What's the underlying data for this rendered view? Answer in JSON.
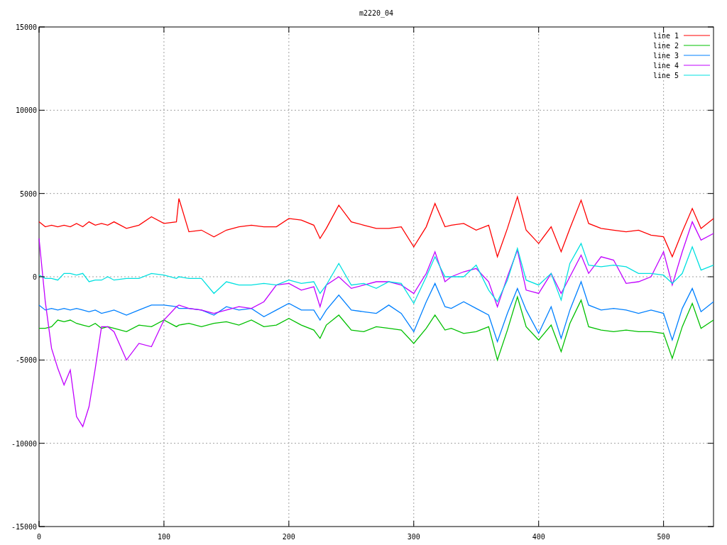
{
  "chart": {
    "chart_data": {
      "type": "line",
      "title": "m2220_04",
      "grid": true,
      "legend": true,
      "xlim": [
        0,
        540
      ],
      "ylim": [
        -15000,
        15000
      ],
      "xticks": [
        0,
        100,
        200,
        300,
        400,
        500
      ],
      "yticks": [
        -15000,
        -10000,
        -5000,
        0,
        5000,
        10000,
        15000
      ],
      "x": [
        0,
        5,
        10,
        15,
        20,
        25,
        30,
        35,
        40,
        45,
        50,
        55,
        60,
        70,
        80,
        90,
        100,
        110,
        112,
        120,
        130,
        140,
        150,
        160,
        170,
        180,
        190,
        200,
        210,
        220,
        225,
        230,
        240,
        250,
        260,
        270,
        280,
        290,
        300,
        310,
        317,
        325,
        330,
        340,
        350,
        360,
        367,
        375,
        383,
        390,
        400,
        410,
        418,
        425,
        434,
        440,
        450,
        460,
        470,
        480,
        490,
        500,
        507,
        515,
        523,
        530,
        540
      ],
      "series": [
        {
          "name": "line 1",
          "color": "#ff0000",
          "values": [
            3300,
            3000,
            3100,
            3000,
            3100,
            3000,
            3200,
            3000,
            3300,
            3100,
            3200,
            3100,
            3300,
            2900,
            3100,
            3600,
            3200,
            3300,
            4700,
            2700,
            2800,
            2400,
            2800,
            3000,
            3100,
            3000,
            3000,
            3500,
            3400,
            3100,
            2300,
            2900,
            4300,
            3300,
            3100,
            2900,
            2900,
            3000,
            1800,
            3000,
            4400,
            3000,
            3100,
            3200,
            2800,
            3100,
            1200,
            2900,
            4800,
            2800,
            2000,
            3000,
            1500,
            2900,
            4600,
            3200,
            2900,
            2800,
            2700,
            2800,
            2500,
            2400,
            1200,
            2700,
            4100,
            2900,
            3500
          ]
        },
        {
          "name": "line 2",
          "color": "#00c000",
          "values": [
            -3100,
            -3100,
            -3000,
            -2600,
            -2700,
            -2600,
            -2800,
            -2900,
            -3000,
            -2800,
            -3100,
            -3000,
            -3100,
            -3300,
            -2900,
            -3000,
            -2600,
            -3000,
            -2900,
            -2800,
            -3000,
            -2800,
            -2700,
            -2900,
            -2600,
            -3000,
            -2900,
            -2500,
            -2900,
            -3200,
            -3700,
            -2900,
            -2300,
            -3200,
            -3300,
            -3000,
            -3100,
            -3200,
            -4000,
            -3100,
            -2300,
            -3200,
            -3100,
            -3400,
            -3300,
            -3000,
            -5000,
            -3200,
            -1200,
            -3000,
            -3800,
            -2900,
            -4500,
            -2800,
            -1400,
            -3000,
            -3200,
            -3300,
            -3200,
            -3300,
            -3300,
            -3400,
            -4900,
            -3000,
            -1600,
            -3100,
            -2600
          ]
        },
        {
          "name": "line 3",
          "color": "#0080ff",
          "values": [
            -1700,
            -2000,
            -1900,
            -2000,
            -1900,
            -2000,
            -1900,
            -2000,
            -2100,
            -2000,
            -2200,
            -2100,
            -2000,
            -2300,
            -2000,
            -1700,
            -1700,
            -1800,
            -1900,
            -1900,
            -2000,
            -2300,
            -1800,
            -2000,
            -1900,
            -2400,
            -2000,
            -1600,
            -2000,
            -2000,
            -2600,
            -2000,
            -1100,
            -2000,
            -2100,
            -2200,
            -1700,
            -2200,
            -3300,
            -1500,
            -400,
            -1800,
            -1900,
            -1500,
            -1900,
            -2300,
            -3900,
            -2200,
            -700,
            -2000,
            -3400,
            -1800,
            -3700,
            -2000,
            -300,
            -1700,
            -2000,
            -1900,
            -2000,
            -2200,
            -2000,
            -2200,
            -3800,
            -1900,
            -700,
            -2100,
            -1500
          ]
        },
        {
          "name": "line 4",
          "color": "#c000ff",
          "values": [
            2300,
            -1500,
            -4300,
            -5500,
            -6500,
            -5600,
            -8400,
            -9000,
            -7800,
            -5500,
            -3000,
            -3000,
            -3300,
            -5000,
            -4000,
            -4200,
            -2600,
            -1800,
            -1700,
            -1900,
            -2000,
            -2200,
            -2000,
            -1800,
            -1900,
            -1500,
            -500,
            -400,
            -800,
            -600,
            -1800,
            -500,
            0,
            -700,
            -500,
            -300,
            -300,
            -500,
            -1000,
            200,
            1500,
            -300,
            0,
            300,
            500,
            -300,
            -1800,
            0,
            1600,
            -800,
            -1000,
            200,
            -1000,
            0,
            1300,
            200,
            1200,
            1000,
            -400,
            -300,
            0,
            1500,
            -500,
            1500,
            3300,
            2200,
            2600
          ]
        },
        {
          "name": "line 5",
          "color": "#00e0e0",
          "values": [
            100,
            -100,
            -100,
            -200,
            200,
            200,
            100,
            200,
            -300,
            -200,
            -200,
            0,
            -200,
            -100,
            -100,
            200,
            100,
            -100,
            0,
            -100,
            -100,
            -1000,
            -300,
            -500,
            -500,
            -400,
            -500,
            -200,
            -400,
            -300,
            -1000,
            -500,
            800,
            -500,
            -400,
            -700,
            -300,
            -400,
            -1600,
            0,
            1200,
            0,
            0,
            0,
            700,
            -800,
            -1500,
            -200,
            1700,
            -200,
            -500,
            200,
            -1400,
            800,
            2000,
            700,
            600,
            700,
            600,
            200,
            200,
            100,
            -400,
            200,
            1800,
            400,
            700
          ]
        }
      ]
    }
  }
}
